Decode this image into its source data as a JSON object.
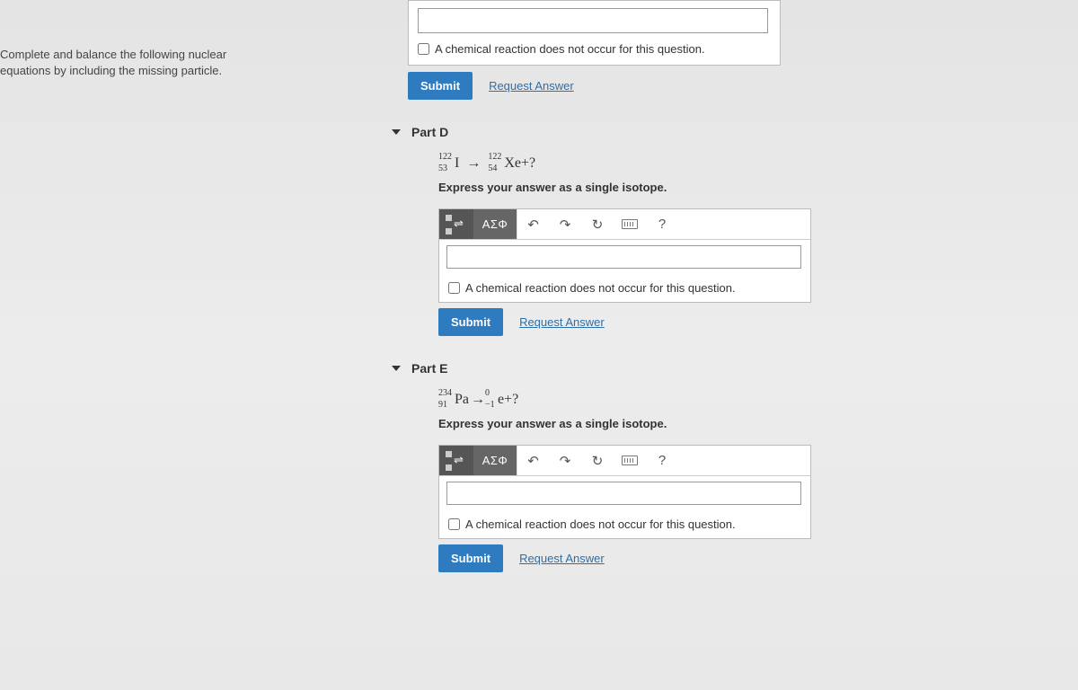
{
  "sidebar": {
    "prompt": "Complete and balance the following nuclear equations by including the missing particle."
  },
  "top": {
    "checkbox_label": "A chemical reaction does not occur for this question.",
    "submit": "Submit",
    "request": "Request Answer"
  },
  "partD": {
    "title": "Part D",
    "eq": {
      "a_mass": "122",
      "a_num": "53",
      "a_sym": "I",
      "arrow": "→",
      "b_mass": "122",
      "b_num": "54",
      "b_sym": "Xe",
      "tail": "+?"
    },
    "instruction": "Express your answer as a single isotope.",
    "toolbar": {
      "greek": "ΑΣΦ",
      "help": "?"
    },
    "checkbox_label": "A chemical reaction does not occur for this question.",
    "submit": "Submit",
    "request": "Request Answer"
  },
  "partE": {
    "title": "Part E",
    "eq": {
      "a_mass": "234",
      "a_num": "91",
      "a_sym": "Pa",
      "arrow": "→",
      "b_mass": "0",
      "b_num": "−1",
      "b_sym": "e",
      "tail": "+?"
    },
    "instruction": "Express your answer as a single isotope.",
    "toolbar": {
      "greek": "ΑΣΦ",
      "help": "?"
    },
    "checkbox_label": "A chemical reaction does not occur for this question.",
    "submit": "Submit",
    "request": "Request Answer"
  }
}
